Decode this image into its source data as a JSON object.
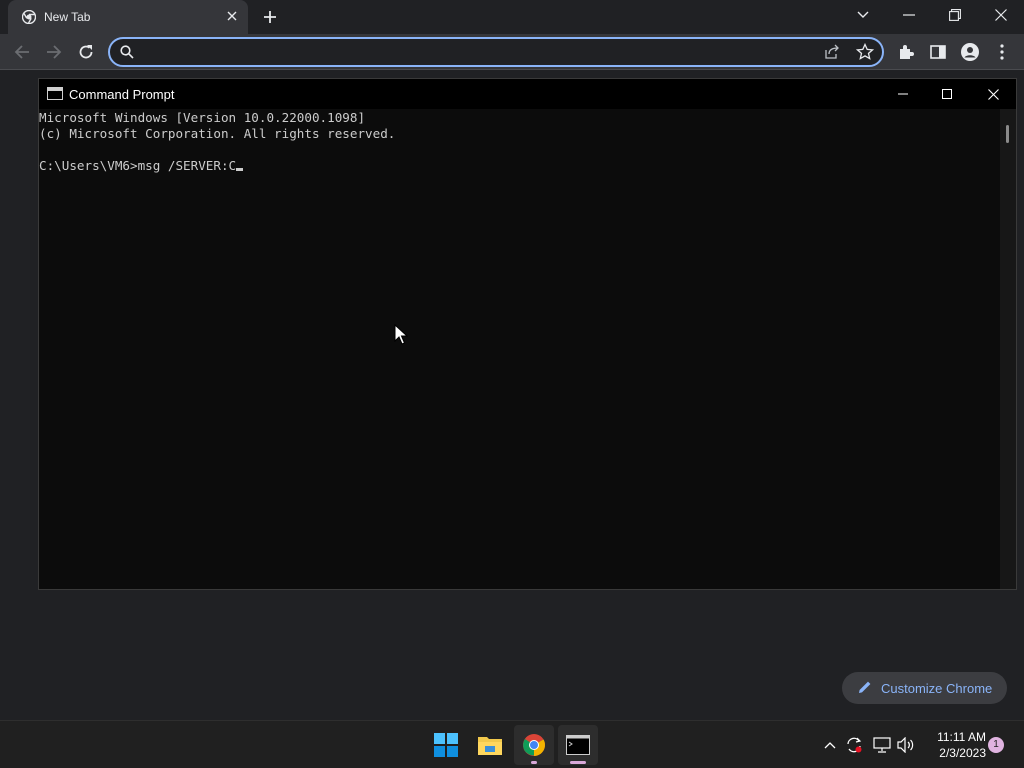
{
  "browser": {
    "tab": {
      "title": "New Tab",
      "favicon": "chrome-icon"
    },
    "omnibox": {
      "value": "",
      "placeholder": ""
    },
    "customize_label": "Customize Chrome"
  },
  "cmd": {
    "title": "Command Prompt",
    "lines": [
      "Microsoft Windows [Version 10.0.22000.1098]",
      "(c) Microsoft Corporation. All rights reserved.",
      "",
      "C:\\Users\\VM6>msg /SERVER:C"
    ]
  },
  "taskbar": {
    "apps": [
      "windows-start-icon",
      "file-explorer-icon",
      "chrome-icon",
      "terminal-icon"
    ],
    "time": "11:11 AM",
    "date": "2/3/2023",
    "notification_count": "1"
  },
  "colors": {
    "accent": "#8ab4f8",
    "cmd_bg": "#0c0c0c",
    "chrome_bg": "#202124"
  }
}
